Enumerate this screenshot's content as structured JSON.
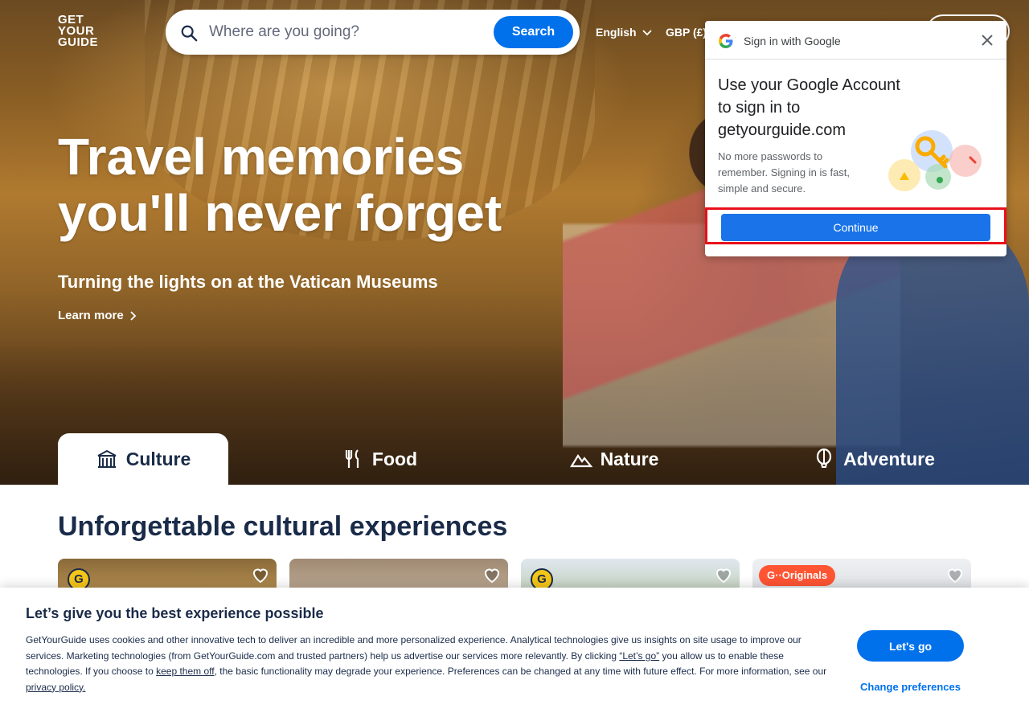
{
  "header": {
    "logo_lines": [
      "GET",
      "YOUR",
      "GUIDE"
    ],
    "search_placeholder": "Where are you going?",
    "search_button": "Search",
    "language": "English",
    "currency": "GBP (£)"
  },
  "hero": {
    "title": "Travel memories you'll never forget",
    "subtitle": "Turning the lights on at the Vatican Museums",
    "link": "Learn more"
  },
  "tabs": [
    {
      "label": "Culture",
      "icon": "culture-icon",
      "active": true
    },
    {
      "label": "Food",
      "icon": "food-icon",
      "active": false
    },
    {
      "label": "Nature",
      "icon": "nature-icon",
      "active": false
    },
    {
      "label": "Adventure",
      "icon": "adventure-icon",
      "active": false
    }
  ],
  "section": {
    "title": "Unforgettable cultural experiences",
    "cards": [
      {
        "badge": "G",
        "badge_type": "gold"
      },
      {
        "badge": "",
        "badge_type": "none"
      },
      {
        "badge": "G",
        "badge_type": "gold"
      },
      {
        "badge": "G··Originals",
        "badge_type": "originals"
      }
    ]
  },
  "google_popup": {
    "title": "Sign in with Google",
    "heading": "Use your Google Account to sign in to getyourguide.com",
    "description": "No more passwords to remember. Signing in is fast, simple and secure.",
    "continue": "Continue"
  },
  "cookie": {
    "title": "Let’s give you the best experience possible",
    "text_1": "GetYourGuide uses cookies and other innovative tech to deliver an incredible and more personalized experience. Analytical technologies give us insights on site usage to improve our services. Marketing technologies (from GetYourGuide.com and trusted partners) help us advertise our services more relevantly. By clicking ",
    "lets_go_quote": "“Let’s go”",
    "text_2": " you allow us to enable these technologies. If you choose to ",
    "keep_off": "keep them off",
    "text_3": ", the basic functionality may degrade your experience. Preferences can be changed at any time with future effect. For more information, see our ",
    "privacy": "privacy policy.",
    "accept": "Let's go",
    "preferences": "Change preferences"
  },
  "colors": {
    "brand_blue": "#0071eb",
    "text_navy": "#1a2b49",
    "google_blue": "#1a73e8",
    "highlight_red": "#e8101a",
    "originals_orange": "#ff5533"
  }
}
